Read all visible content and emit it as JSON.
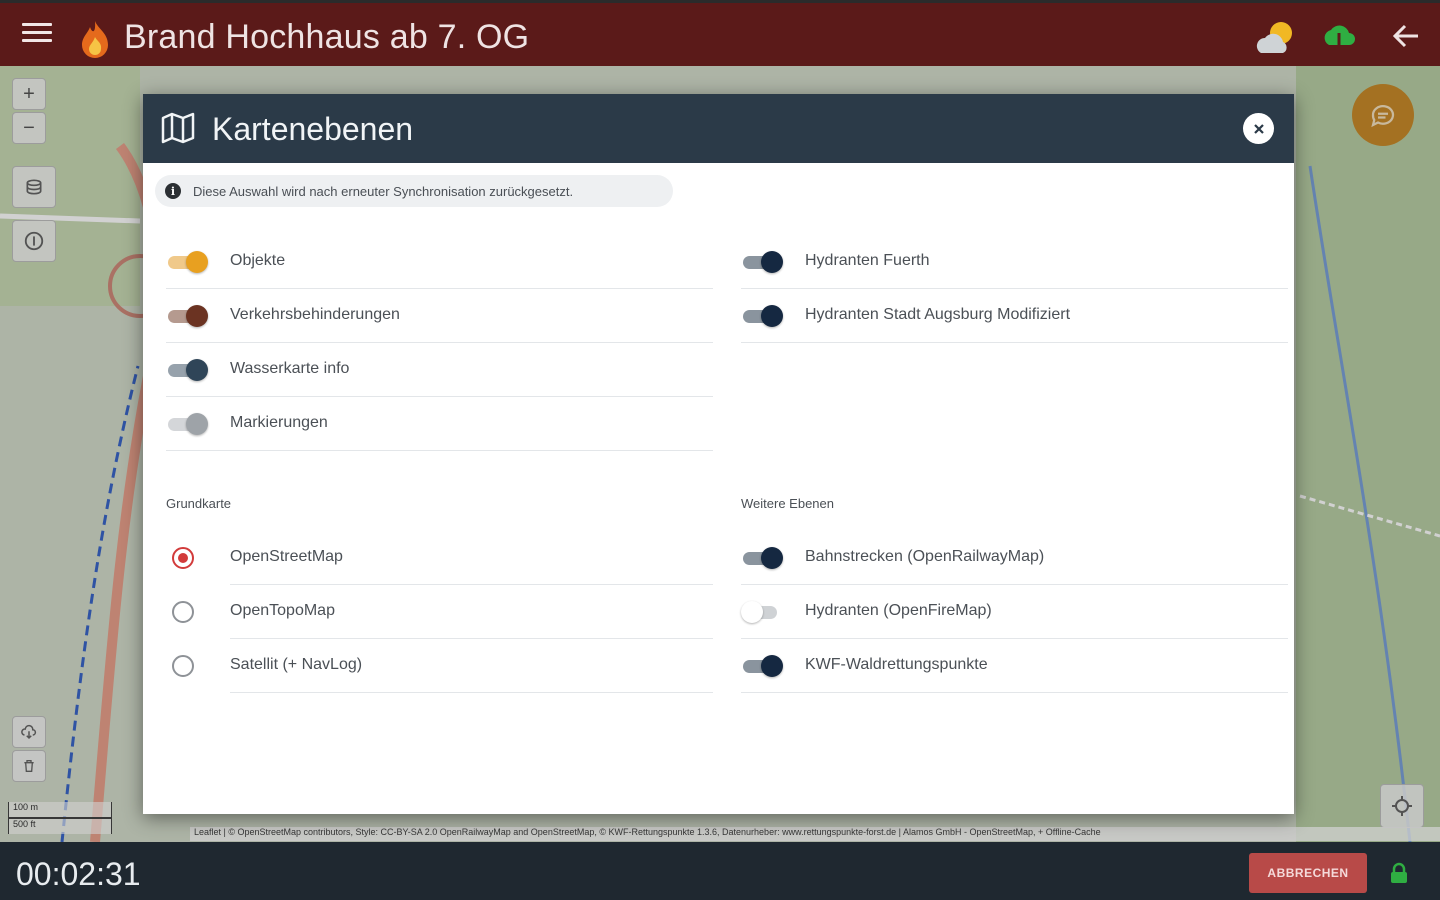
{
  "app": {
    "title": "Brand Hochhaus ab 7. OG"
  },
  "dialog": {
    "title": "Kartenebenen",
    "info": "Diese Auswahl wird nach erneuter Synchronisation zurückgesetzt.",
    "left_layers": [
      {
        "label": "Objekte",
        "on": true,
        "color": "#e8a020"
      },
      {
        "label": "Verkehrsbehinderungen",
        "on": true,
        "color": "#6b3322"
      },
      {
        "label": "Wasserkarte info",
        "on": true,
        "color": "#2f4558"
      },
      {
        "label": "Markierungen",
        "on": true,
        "color": "#9ea3a8"
      }
    ],
    "right_layers": [
      {
        "label": "Hydranten Fuerth",
        "on": true,
        "color": "#152841"
      },
      {
        "label": "Hydranten Stadt Augsburg Modifiziert",
        "on": true,
        "color": "#152841"
      }
    ],
    "base_map": {
      "label": "Grundkarte",
      "options": [
        {
          "label": "OpenStreetMap",
          "selected": true
        },
        {
          "label": "OpenTopoMap",
          "selected": false
        },
        {
          "label": "Satellit (+ NavLog)",
          "selected": false
        }
      ]
    },
    "extra_layers": {
      "label": "Weitere Ebenen",
      "items": [
        {
          "label": "Bahnstrecken (OpenRailwayMap)",
          "on": true,
          "color": "#152841"
        },
        {
          "label": "Hydranten (OpenFireMap)",
          "on": false,
          "color": "#ffffff"
        },
        {
          "label": "KWF-Waldrettungspunkte",
          "on": true,
          "color": "#152841"
        }
      ]
    }
  },
  "map": {
    "attribution": "Leaflet | © OpenStreetMap contributors, Style: CC-BY-SA 2.0 OpenRailwayMap and OpenStreetMap, © KWF-Rettungspunkte 1.3.6, Datenurheber: www.rettungspunkte-forst.de | Alamos GmbH - OpenStreetMap, + Offline-Cache",
    "scale_metric": "100 m",
    "scale_imperial": "500 ft"
  },
  "footer": {
    "timer": "00:02:31",
    "cancel_label": "ABBRECHEN"
  }
}
